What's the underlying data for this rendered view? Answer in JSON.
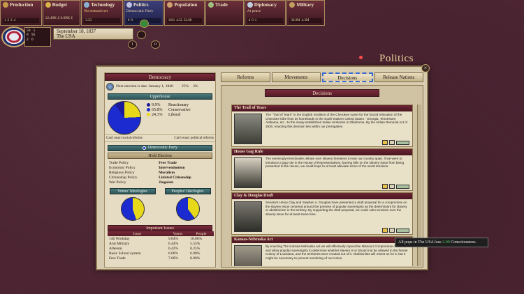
{
  "topbar": {
    "tabs": [
      {
        "label": "Production",
        "sub": "",
        "sub2": "",
        "bar": [
          "1",
          "2",
          "3",
          "4"
        ]
      },
      {
        "label": "Budget",
        "sub": "",
        "sub2": "12.49K £  6.09K £",
        "bar": [
          "",
          ""
        ]
      },
      {
        "label": "Technology",
        "sub": "No research set",
        "sub2": "",
        "bar": [
          "3.33"
        ]
      },
      {
        "label": "Politics",
        "sub": "Democratic Party",
        "sub2": "",
        "bar": [
          "0",
          "0"
        ]
      },
      {
        "label": "Population",
        "sub": "",
        "sub2": "",
        "bar": [
          "8.81",
          "4.52",
          "",
          "22.68"
        ]
      },
      {
        "label": "Trade",
        "sub": "",
        "sub2": "",
        "bar": [
          "",
          ""
        ]
      },
      {
        "label": "Diplomacy",
        "sub": "",
        "sub2": "At peace",
        "bar": [
          "4",
          "0",
          "1"
        ]
      },
      {
        "label": "Military",
        "sub": "",
        "sub2": "",
        "bar": [
          "36.9M",
          "4.3M"
        ]
      }
    ]
  },
  "nation": {
    "stats": [
      "50",
      "8",
      "2"
    ],
    "stats_right": [
      "5",
      "95",
      "0"
    ],
    "date": "September 18, 1837",
    "country": "The USA",
    "speed": [
      "1",
      "0"
    ]
  },
  "screen_title": "Politics",
  "window": {
    "close": "×",
    "government": {
      "title": "Democracy",
      "election": "Next election is due: January 1, 1840",
      "plurality": "25%",
      "revanchism": "3%"
    },
    "upperhouse": {
      "title": "Upperhouse",
      "parties": [
        {
          "pct": "9.9%",
          "name": "Reactionary",
          "color": "#1a1a9a"
        },
        {
          "pct": "65.8%",
          "name": "Conservative",
          "color": "#1c2bd0"
        },
        {
          "pct": "24.3%",
          "name": "Liberal",
          "color": "#e8d81a"
        }
      ],
      "reforms": [
        "Can't enact social reforms",
        "Can't enact political reforms"
      ]
    },
    "ruling_party": {
      "name": "Democratic Party",
      "action": "Hold Election",
      "policies": [
        [
          "Trade Policy",
          "Free Trade"
        ],
        [
          "Economic Policy",
          "Interventionism"
        ],
        [
          "Religious Policy",
          "Moralism"
        ],
        [
          "Citizenship Policy",
          "Limited Citizenship"
        ],
        [
          "War Policy",
          "Jingoism"
        ]
      ]
    },
    "ideologies": {
      "voters": "Voters' Ideologies",
      "people": "Peoples' Ideologies"
    },
    "issues": {
      "title": "Important Issues",
      "headers": [
        "Issue",
        "Voters",
        "People"
      ],
      "rows": [
        [
          "14h Workday",
          "9.84%",
          "10.86%"
        ],
        [
          "Anti Military",
          "6.44%",
          "5.55%"
        ],
        [
          "Atheism",
          "0.42%",
          "0.25%"
        ],
        [
          "Basic School system",
          "6.00%",
          "6.00%"
        ],
        [
          "Free Trade",
          "7.00%",
          "8.00%"
        ]
      ]
    },
    "tabs": [
      "Reforms",
      "Movements",
      "Decisions",
      "Release Nations"
    ],
    "decisions_title": "Decisions",
    "decisions": [
      {
        "title": "The Trail of Tears",
        "text": "The \"Trail of Tears\" is the English rendition of the Cherokee name for the forced relocation of the Cherokee tribe from its homelands in the south-eastern United States - Georgia, Tennessee, Alabama, etc - to the newly-established Indian territories in Oklahoma. By the Indian Removal Act of 1830, enacting this decision lies within our prerogative."
      },
      {
        "title": "House Gag Rule",
        "text": "The seemingly-irresolvable debate over slavery threatens to tear our country apart. If we were to introduce a gag rule in the House of Representatives, barring bills on the slavery issue from being presented to the House, we could hope to at least alleviate some of the worst tensions."
      },
      {
        "title": "Clay & Douglas Draft",
        "text": "Senators Henry Clay and Stephen A. Douglas have presented a draft proposal for a compromise on the slavery issue centered around the premise of popular sovereignty as the determinant for slavery or abolitionism in the territory. By supporting the draft proposal, we could calm tensions over the slavery issue for at least some time."
      },
      {
        "title": "Kansas-Nebraska Act",
        "text": "By enacting The Kansas-Nebraska act we will effectively repeal the Missouri Compromise of 1820, and allow popular sovereignty to determine whether slavery is or should not be allowed in the former Colony of Louisiana, and the territories were created out of it. Abolitionists will resent us for it, but it might be necessary to prevent sundering of our Union."
      }
    ]
  },
  "tooltip": {
    "a": "All pops in The USA lose",
    "b": "2.00",
    "c": "Consciousness."
  },
  "colors": {
    "accent": "#7b2a3a",
    "pie_blue": "#1c2bd0",
    "pie_yellow": "#e8d81a"
  },
  "icons": [
    "globe-icon",
    "close-icon",
    "flag-icon"
  ]
}
